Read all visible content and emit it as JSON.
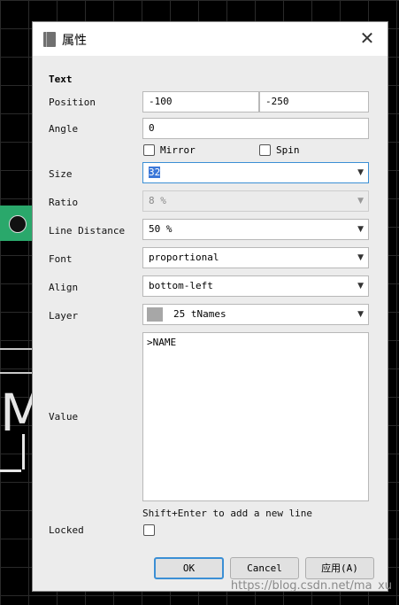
{
  "dialog": {
    "title": "属性",
    "close_symbol": "✕",
    "section_title": "Text",
    "position": {
      "label": "Position",
      "x": "-100",
      "y": "-250"
    },
    "angle": {
      "label": "Angle",
      "value": "0"
    },
    "mirror": {
      "label": "Mirror",
      "checked": false
    },
    "spin": {
      "label": "Spin",
      "checked": false
    },
    "size": {
      "label": "Size",
      "value": "32"
    },
    "ratio": {
      "label": "Ratio",
      "value": "8 %"
    },
    "line_distance": {
      "label": "Line Distance",
      "value": "50 %"
    },
    "font": {
      "label": "Font",
      "value": "proportional"
    },
    "align": {
      "label": "Align",
      "value": "bottom-left"
    },
    "layer": {
      "label": "Layer",
      "value": "25 tNames",
      "swatch_color": "#a7a7a7"
    },
    "value": {
      "label": "Value",
      "text": ">NAME",
      "hint": "Shift+Enter to add a new line"
    },
    "locked": {
      "label": "Locked",
      "checked": false
    },
    "buttons": {
      "ok": "OK",
      "cancel": "Cancel",
      "apply": "应用(A)"
    }
  },
  "background": {
    "letter": "M",
    "watermark": "https://blog.csdn.net/ma_xu"
  },
  "colors": {
    "focus": "#3b8fd5",
    "selection": "#3c78d8",
    "canvas": "#000000",
    "pad": "#2aa86b"
  }
}
